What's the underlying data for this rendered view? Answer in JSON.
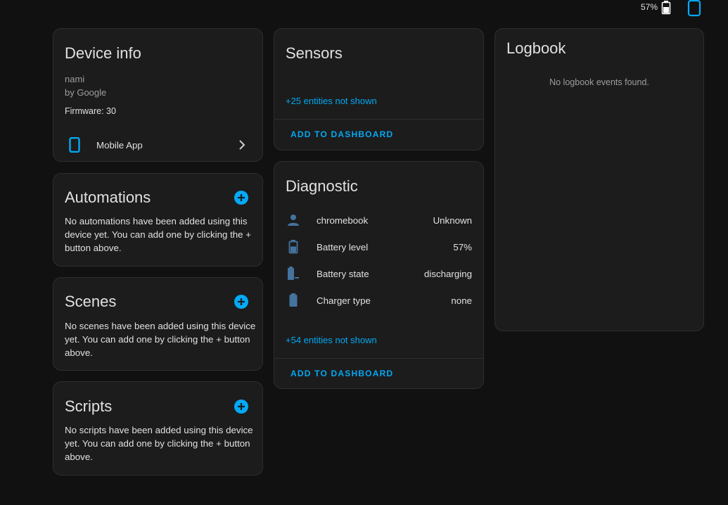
{
  "topbar": {
    "battery_percent": "57%"
  },
  "device_info": {
    "title": "Device info",
    "model": "nami",
    "manufacturer": "by Google",
    "firmware": "Firmware: 30",
    "integration": "Mobile App"
  },
  "automations": {
    "title": "Automations",
    "empty_text": "No automations have been added using this device yet. You can add one by clicking the + button above."
  },
  "scenes": {
    "title": "Scenes",
    "empty_text": "No scenes have been added using this device yet. You can add one by clicking the + button above."
  },
  "scripts": {
    "title": "Scripts",
    "empty_text": "No scripts have been added using this device yet. You can add one by clicking the + button above."
  },
  "sensors": {
    "title": "Sensors",
    "hidden_link": "+25 entities not shown",
    "action": "ADD TO DASHBOARD"
  },
  "diagnostic": {
    "title": "Diagnostic",
    "entities": [
      {
        "icon": "account-icon",
        "name": "chromebook",
        "value": "Unknown"
      },
      {
        "icon": "battery-icon",
        "name": "Battery level",
        "value": "57%"
      },
      {
        "icon": "battery-discharging-icon",
        "name": "Battery state",
        "value": "discharging"
      },
      {
        "icon": "battery-full-icon",
        "name": "Charger type",
        "value": "none"
      }
    ],
    "hidden_link": "+54 entities not shown",
    "action": "ADD TO DASHBOARD"
  },
  "logbook": {
    "title": "Logbook",
    "empty_text": "No logbook events found."
  },
  "colors": {
    "accent": "#03a9f4",
    "entity_icon": "#44739e",
    "card_bg": "#1c1c1c",
    "page_bg": "#111111"
  }
}
